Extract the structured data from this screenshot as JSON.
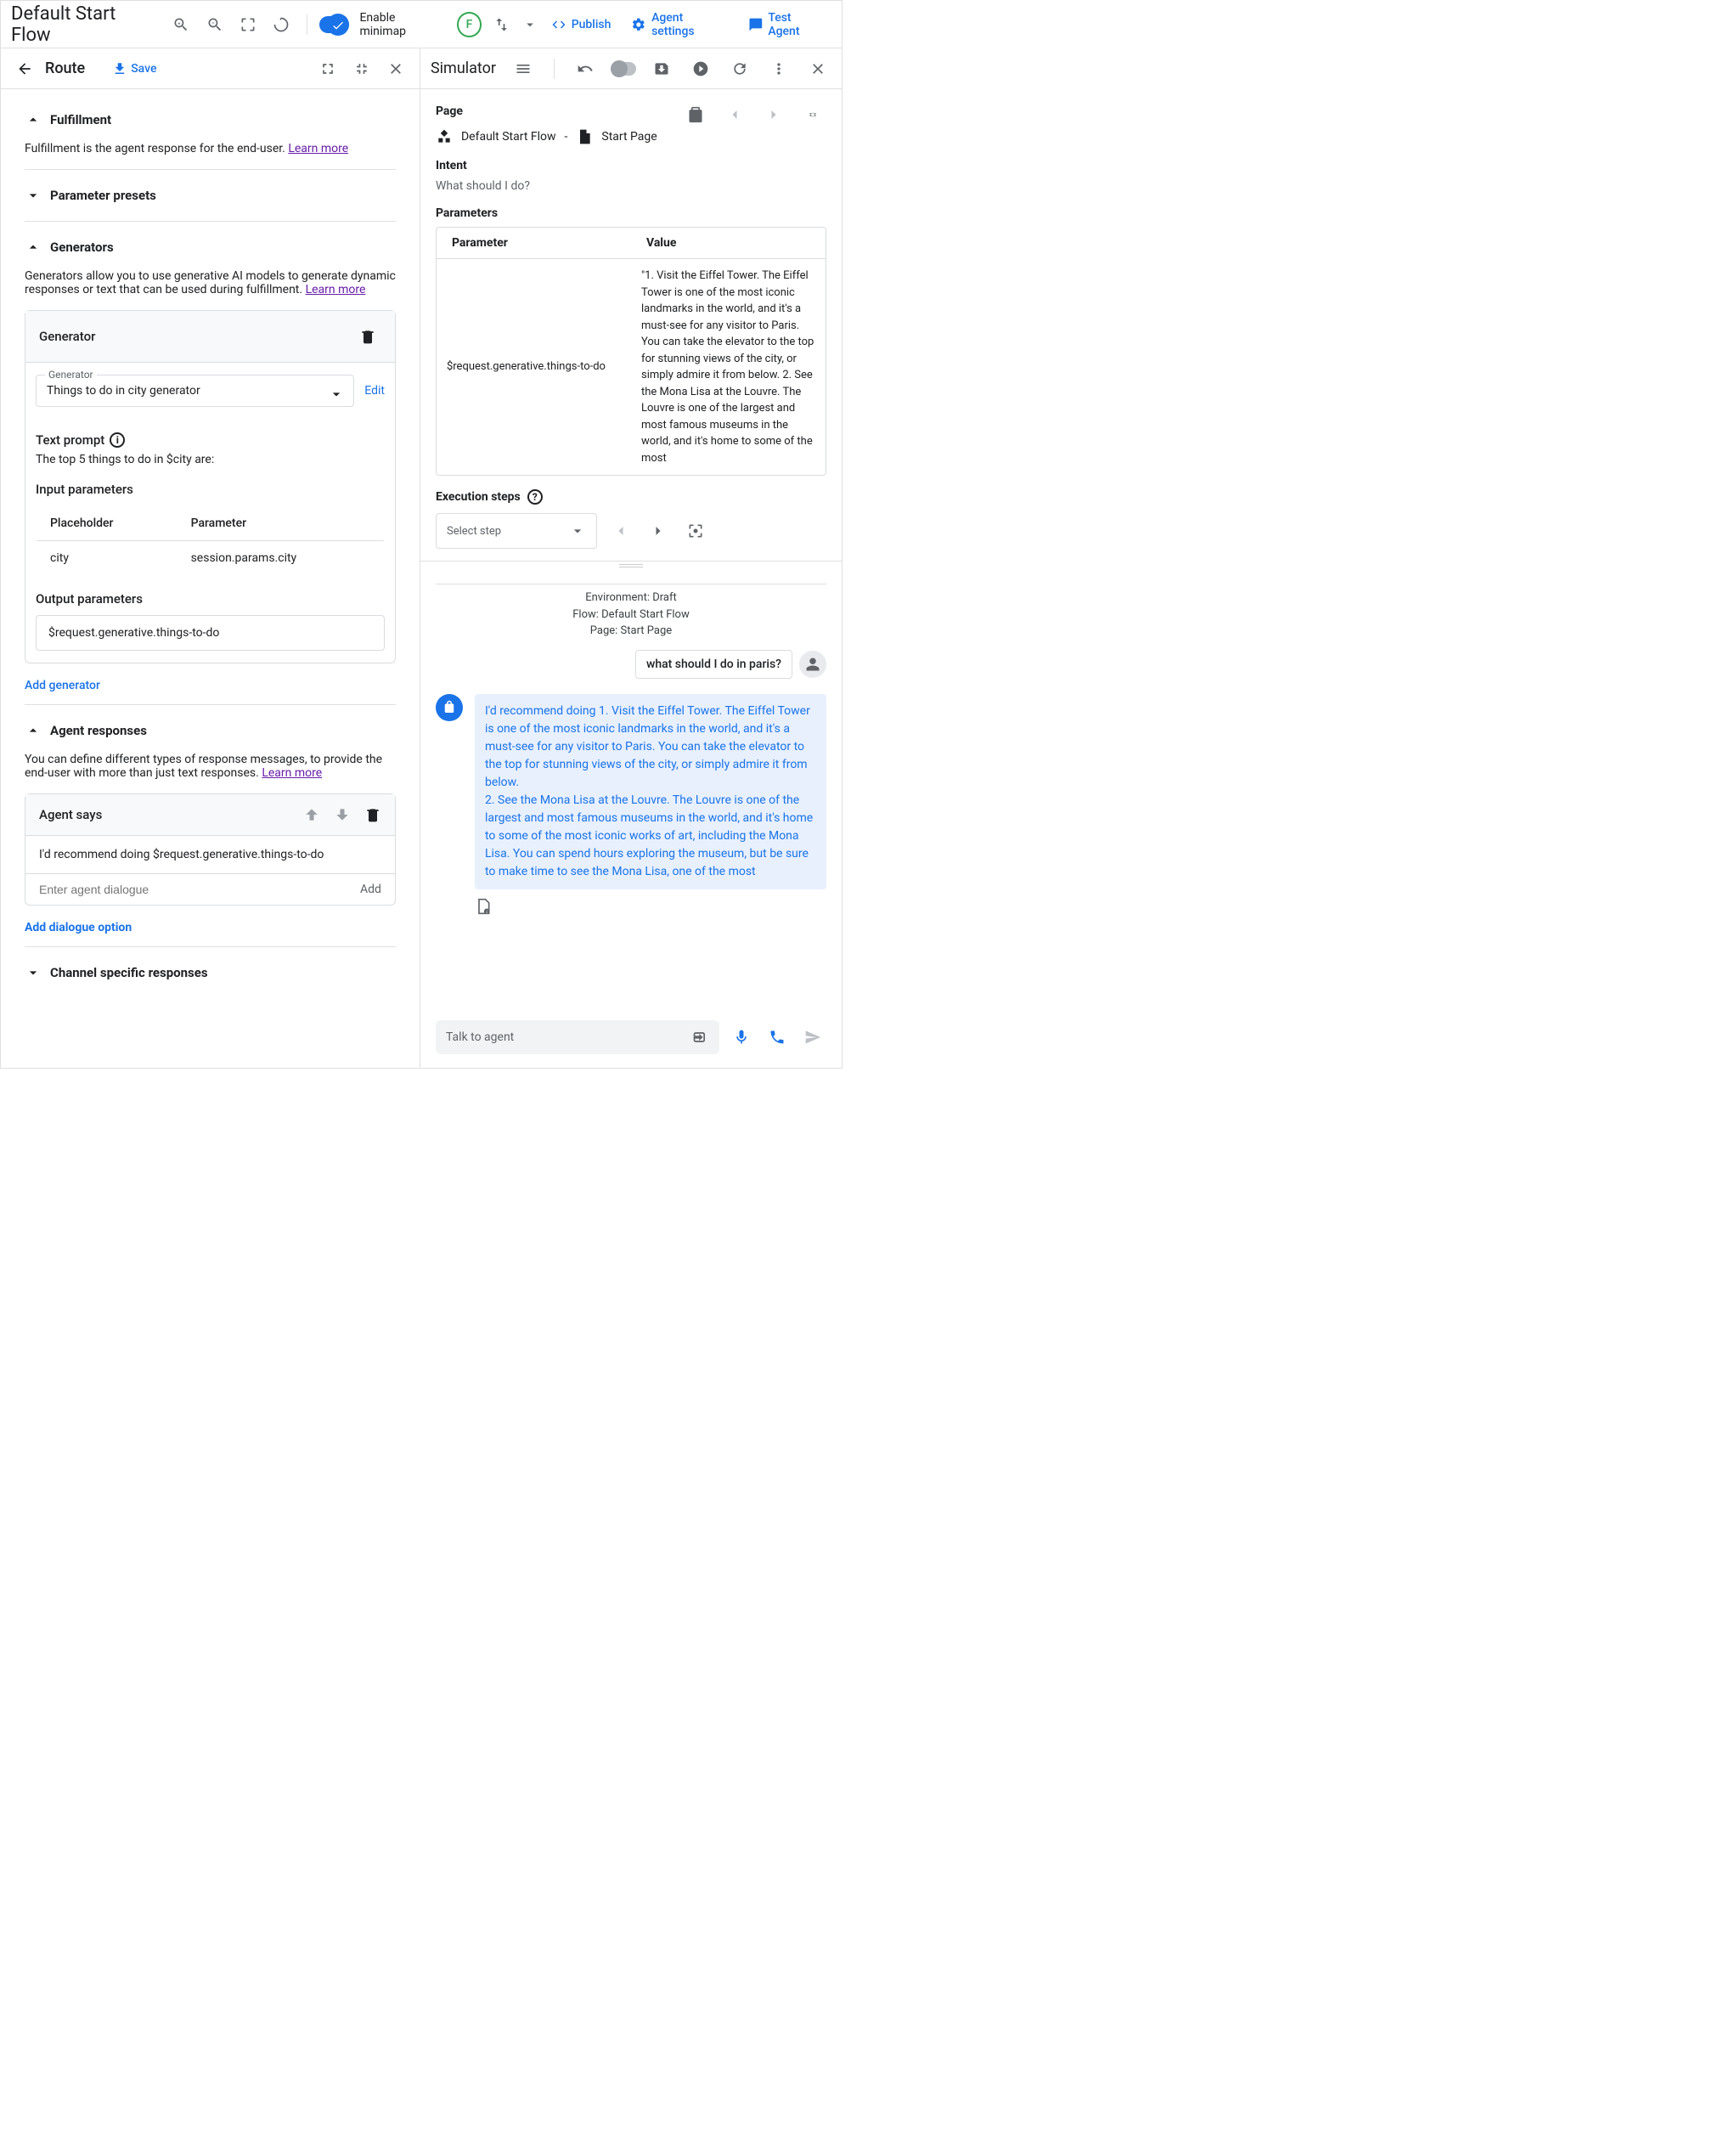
{
  "topbar": {
    "title": "Default Start Flow",
    "minimap_label": "Enable minimap",
    "avatar_letter": "F",
    "publish": "Publish",
    "agent_settings": "Agent settings",
    "test_agent": "Test Agent"
  },
  "route_panel": {
    "title": "Route",
    "save": "Save",
    "fulfillment": {
      "title": "Fulfillment",
      "desc": "Fulfillment is the agent response for the end-user. ",
      "learn_more": "Learn more"
    },
    "param_presets": "Parameter presets",
    "generators": {
      "title": "Generators",
      "desc": "Generators allow you to use generative AI models to generate dynamic responses or text that can be used during fulfillment. ",
      "learn_more": "Learn more",
      "card_title": "Generator",
      "select_label": "Generator",
      "select_value": "Things to do in city generator",
      "edit": "Edit",
      "text_prompt_label": "Text prompt",
      "text_prompt_value": "The top 5 things to do in $city are:",
      "input_params_label": "Input parameters",
      "col_placeholder": "Placeholder",
      "col_parameter": "Parameter",
      "row_placeholder": "city",
      "row_parameter": "session.params.city",
      "output_params_label": "Output parameters",
      "output_value": "$request.generative.things-to-do",
      "add_generator": "Add generator"
    },
    "agent_responses": {
      "title": "Agent responses",
      "desc": "You can define different types of response messages, to provide the end-user with more than just text responses. ",
      "learn_more": "Learn more",
      "agent_says": "Agent says",
      "response_text": "I'd recommend doing  $request.generative.things-to-do",
      "placeholder": "Enter agent dialogue",
      "add_btn": "Add",
      "add_dialogue": "Add dialogue option"
    },
    "channel_specific": "Channel specific responses"
  },
  "simulator": {
    "title": "Simulator",
    "page_label": "Page",
    "breadcrumb_flow": "Default Start Flow",
    "breadcrumb_page": "Start Page",
    "intent_label": "Intent",
    "intent_value": "What should I do?",
    "params_label": "Parameters",
    "col_param": "Parameter",
    "col_value": "Value",
    "param_name": "$request.generative.things-to-do",
    "param_value": "\"1. Visit the Eiffel Tower. The Eiffel Tower is one of the most iconic landmarks in the world, and it's a must-see for any visitor to Paris. You can take the elevator to the top for stunning views of the city, or simply admire it from below. 2. See the Mona Lisa at the Louvre. The Louvre is one of the largest and most famous museums in the world, and it's home to some of the most",
    "exec_label": "Execution steps",
    "step_placeholder": "Select step",
    "env_line1": "Environment: Draft",
    "env_line2": "Flow: Default Start Flow",
    "env_line3": "Page: Start Page",
    "user_msg": "what should I do in paris?",
    "bot_msg": "I'd recommend doing 1. Visit the Eiffel Tower. The Eiffel Tower is one of the most iconic landmarks in the world, and it's a must-see for any visitor to Paris. You can take the elevator to the top for stunning views of the city, or simply admire it from below.\n2. See the Mona Lisa at the Louvre. The Louvre is one of the largest and most famous museums in the world, and it's home to some of the most iconic works of art, including the Mona Lisa. You can spend hours exploring the museum, but be sure to make time to see the Mona Lisa, one of the most",
    "input_placeholder": "Talk to agent"
  }
}
